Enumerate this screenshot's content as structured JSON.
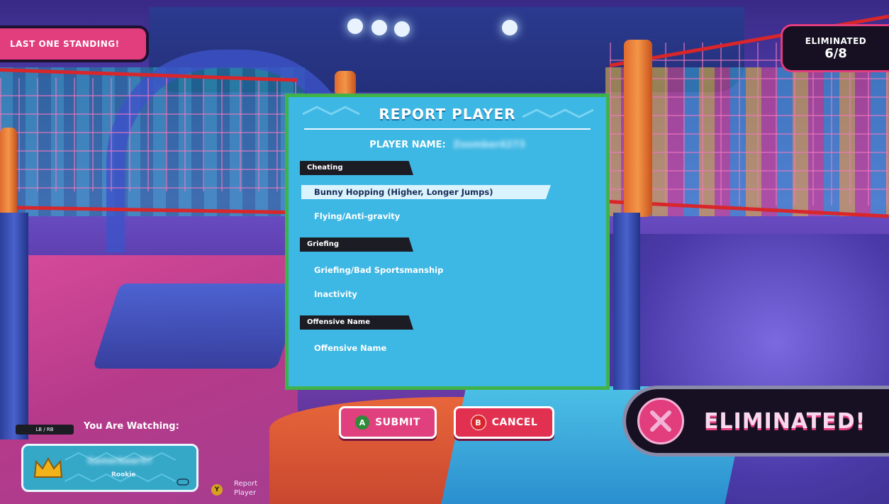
{
  "hud": {
    "round_name": "LAST ONE STANDING!",
    "eliminated_label": "ELIMINATED",
    "eliminated_count": "6/8"
  },
  "report_dialog": {
    "title": "REPORT PLAYER",
    "player_name_label": "PLAYER NAME:",
    "player_name_value": "Zoomber4273",
    "categories": [
      {
        "label": "Cheating",
        "options": [
          "Bunny Hopping (Higher, Longer Jumps)",
          "Flying/Anti-gravity"
        ]
      },
      {
        "label": "Griefing",
        "options": [
          "Griefing/Bad Sportsmanship",
          "Inactivity"
        ]
      },
      {
        "label": "Offensive Name",
        "options": [
          "Offensive Name"
        ]
      }
    ],
    "selected_option": "Bunny Hopping (Higher, Longer Jumps)"
  },
  "buttons": {
    "submit_key": "A",
    "submit_label": "SUBMIT",
    "cancel_key": "B",
    "cancel_label": "CANCEL"
  },
  "spectate": {
    "switch_keys": "LB / RB",
    "watching_label": "You Are Watching:",
    "player_name": "Gamerbear97",
    "rank": "Rookie",
    "report_key": "Y",
    "report_label_line1": "Report",
    "report_label_line2": "Player"
  },
  "status": {
    "banner": "ELIMINATED!"
  },
  "colors": {
    "dialog_bg": "#3db7e3",
    "dialog_border": "#3fb34a",
    "accent_pink": "#e23d7d",
    "dark_label": "#1c1c24"
  },
  "icons": [
    "crown-icon",
    "x-icon",
    "gamepad-icon",
    "a-button-icon",
    "b-button-icon",
    "y-button-icon"
  ]
}
